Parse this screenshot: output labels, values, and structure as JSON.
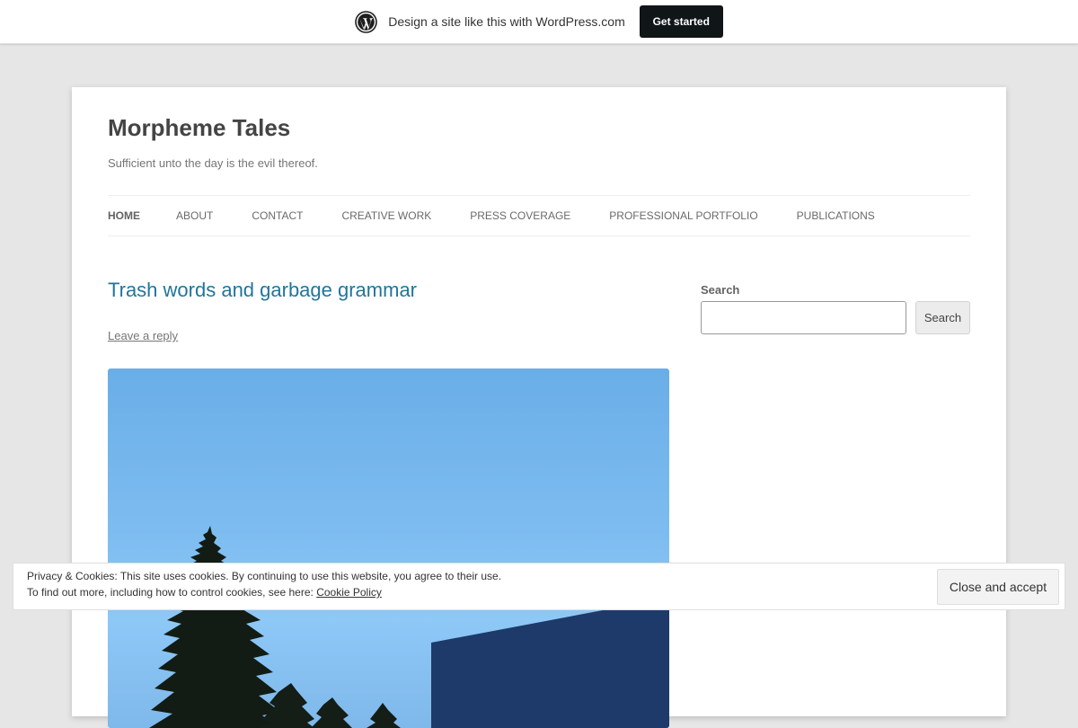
{
  "promo_bar": {
    "text": "Design a site like this with WordPress.com",
    "button_label": "Get started"
  },
  "site": {
    "title": "Morpheme Tales",
    "description": "Sufficient unto the day is the evil thereof."
  },
  "nav": {
    "items": [
      {
        "label": "HOME",
        "current": true
      },
      {
        "label": "ABOUT"
      },
      {
        "label": "CONTACT"
      },
      {
        "label": "CREATIVE WORK"
      },
      {
        "label": "PRESS COVERAGE"
      },
      {
        "label": "PROFESSIONAL PORTFOLIO"
      },
      {
        "label": "PUBLICATIONS"
      }
    ]
  },
  "post": {
    "title": "Trash words and garbage grammar",
    "leave_reply": "Leave a reply"
  },
  "sidebar": {
    "search_title": "Search",
    "search_value": "",
    "search_button": "Search"
  },
  "cookie_banner": {
    "line1": "Privacy & Cookies: This site uses cookies. By continuing to use this website, you agree to their use.",
    "line2_prefix": "To find out more, including how to control cookies, see here: ",
    "link_text": "Cookie Policy",
    "button_label": "Close and accept"
  },
  "colors": {
    "link": "#21759b",
    "promo_button_bg": "#101517",
    "page_bg": "#e6e6e6"
  }
}
